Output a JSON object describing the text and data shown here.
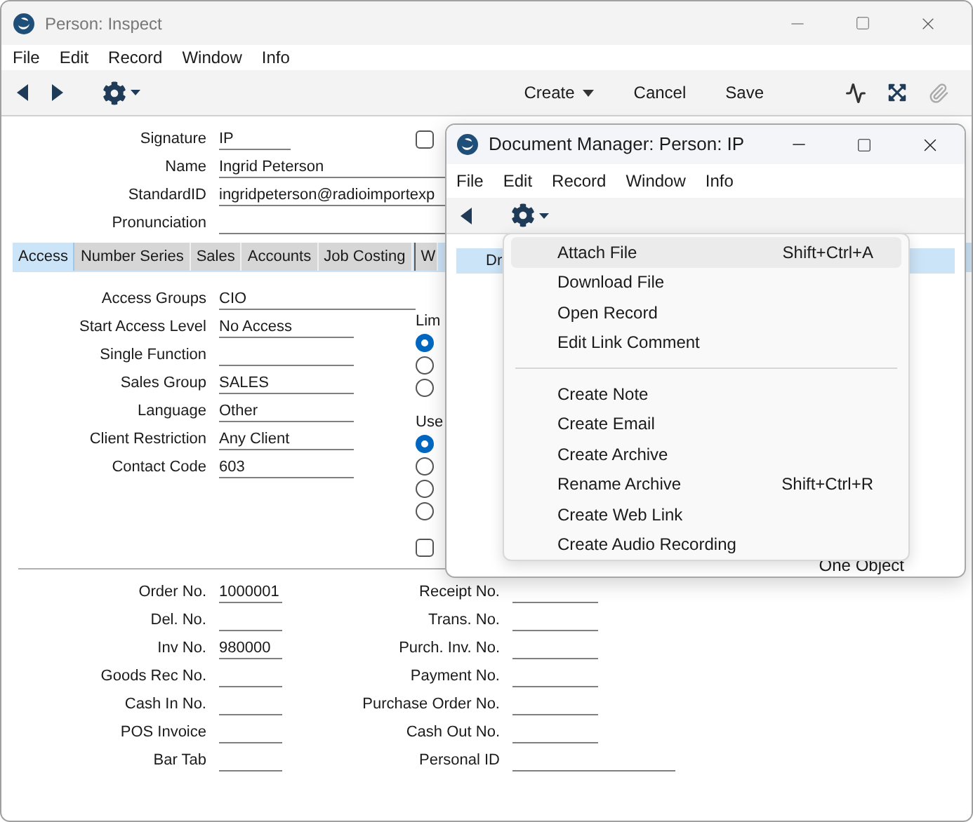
{
  "window": {
    "title": "Person: Inspect"
  },
  "menu": [
    "File",
    "Edit",
    "Record",
    "Window",
    "Info"
  ],
  "toolbar": [
    {
      "label": "Create",
      "kind": "dropdown"
    },
    {
      "label": "Cancel",
      "kind": "plain"
    },
    {
      "label": "Save",
      "kind": "plain"
    }
  ],
  "header_fields": [
    {
      "label": "Signature",
      "value": "IP"
    },
    {
      "label": "Name",
      "value": "Ingrid Peterson"
    },
    {
      "label": "StandardID",
      "value": "ingridpeterson@radioimportexp"
    },
    {
      "label": "Pronunciation"
    }
  ],
  "top_checkbox": {
    "checked": false
  },
  "tabs": [
    {
      "label": "Access",
      "selected": true
    },
    {
      "label": "Number Series",
      "selected": false
    },
    {
      "label": "Sales",
      "selected": false
    },
    {
      "label": "Accounts",
      "selected": false
    },
    {
      "label": "Job Costing",
      "selected": false
    },
    {
      "label": "W",
      "selected": false
    }
  ],
  "access_fields": [
    {
      "label": "Access Groups",
      "value": "CIO"
    },
    {
      "label": "Start Access Level",
      "value": "No Access"
    },
    {
      "label": "Single Function"
    },
    {
      "label": "Sales Group",
      "value": "SALES"
    },
    {
      "label": "Language",
      "value": "Other"
    },
    {
      "label": "Client Restriction",
      "value": "Any Client"
    },
    {
      "label": "Contact Code",
      "value": "603"
    }
  ],
  "radio_groups": [
    {
      "label": "Lim",
      "options": [
        {
          "selected": true
        },
        {
          "selected": false
        },
        {
          "selected": false
        }
      ]
    },
    {
      "label": "Use",
      "options": [
        {
          "selected": true
        },
        {
          "selected": false
        },
        {
          "selected": false
        },
        {
          "selected": false
        }
      ]
    }
  ],
  "bottom_checkbox": {
    "checked": false
  },
  "number_fields_left": [
    {
      "label": "Order No.",
      "value": "1000001"
    },
    {
      "label": "Del. No."
    },
    {
      "label": "Inv No.",
      "value": "980000"
    },
    {
      "label": "Goods Rec No."
    },
    {
      "label": "Cash In No."
    },
    {
      "label": "POS Invoice"
    },
    {
      "label": "Bar Tab"
    }
  ],
  "number_fields_right": [
    {
      "label": "Receipt No."
    },
    {
      "label": "Trans. No."
    },
    {
      "label": "Purch. Inv. No."
    },
    {
      "label": "Payment No."
    },
    {
      "label": "Purchase Order No."
    },
    {
      "label": "Cash Out No."
    },
    {
      "label": "Personal ID"
    }
  ],
  "document_manager": {
    "title": "Document Manager: Person: IP",
    "menu": [
      "File",
      "Edit",
      "Record",
      "Window",
      "Info"
    ],
    "rows": [
      {
        "text": "Dr",
        "selected": true
      }
    ],
    "footer": "One Object"
  },
  "context_menu": [
    {
      "kind": "item",
      "label": "Attach File",
      "shortcut": "Shift+Ctrl+A",
      "selected": true
    },
    {
      "kind": "item",
      "label": "Download File",
      "selected": false
    },
    {
      "kind": "item",
      "label": "Open Record",
      "selected": false
    },
    {
      "kind": "item",
      "label": "Edit Link Comment",
      "selected": false
    },
    {
      "kind": "separator"
    },
    {
      "kind": "item",
      "label": "Create Note",
      "selected": false
    },
    {
      "kind": "item",
      "label": "Create Email",
      "selected": false
    },
    {
      "kind": "item",
      "label": "Create Archive",
      "selected": false
    },
    {
      "kind": "item",
      "label": "Rename Archive",
      "shortcut": "Shift+Ctrl+R",
      "selected": false
    },
    {
      "kind": "item",
      "label": "Create Web Link",
      "selected": false
    },
    {
      "kind": "item",
      "label": "Create Audio Recording",
      "selected": false
    }
  ]
}
